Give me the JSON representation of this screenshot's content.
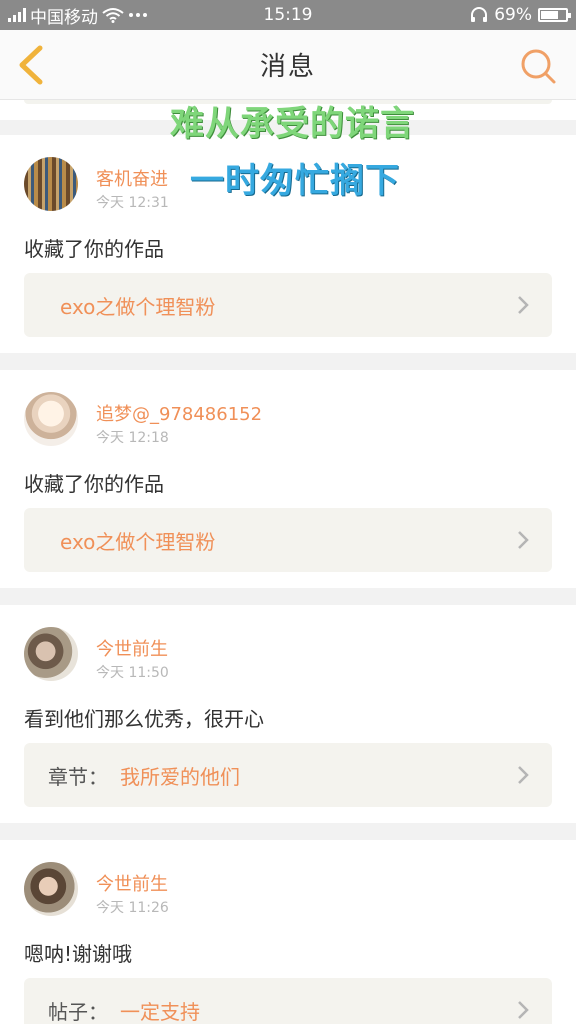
{
  "status": {
    "carrier": "中国移动",
    "time": "15:19",
    "battery": "69%",
    "battery_level": 0.69,
    "icons": [
      "signal-icon",
      "wifi-icon",
      "more-icon",
      "headphone-icon",
      "battery-icon"
    ]
  },
  "nav": {
    "title": "消息",
    "back_icon": "chevron-left-icon",
    "search_icon": "search-icon"
  },
  "overlay": {
    "line1": "难从承受的诺言",
    "line2": "一时匆忙搁下"
  },
  "messages": [
    {
      "name": "客机奋进",
      "time": "今天 12:31",
      "text": "收藏了你的作品",
      "ref_label": "",
      "ref_link": "exo之做个理智粉"
    },
    {
      "name": "追梦@_978486152",
      "time": "今天 12:18",
      "text": "收藏了你的作品",
      "ref_label": "",
      "ref_link": "exo之做个理智粉"
    },
    {
      "name": "今世前生",
      "time": "今天 11:50",
      "text": "看到他们那么优秀，很开心",
      "ref_label": "章节：",
      "ref_link": "我所爱的他们"
    },
    {
      "name": "今世前生",
      "time": "今天 11:26",
      "text": "嗯呐!谢谢哦",
      "ref_label": "帖子：",
      "ref_link": "一定支持"
    }
  ],
  "colors": {
    "accent": "#f09058",
    "status_bg": "#8a8a8a",
    "ref_bg": "#f4f3ee"
  }
}
